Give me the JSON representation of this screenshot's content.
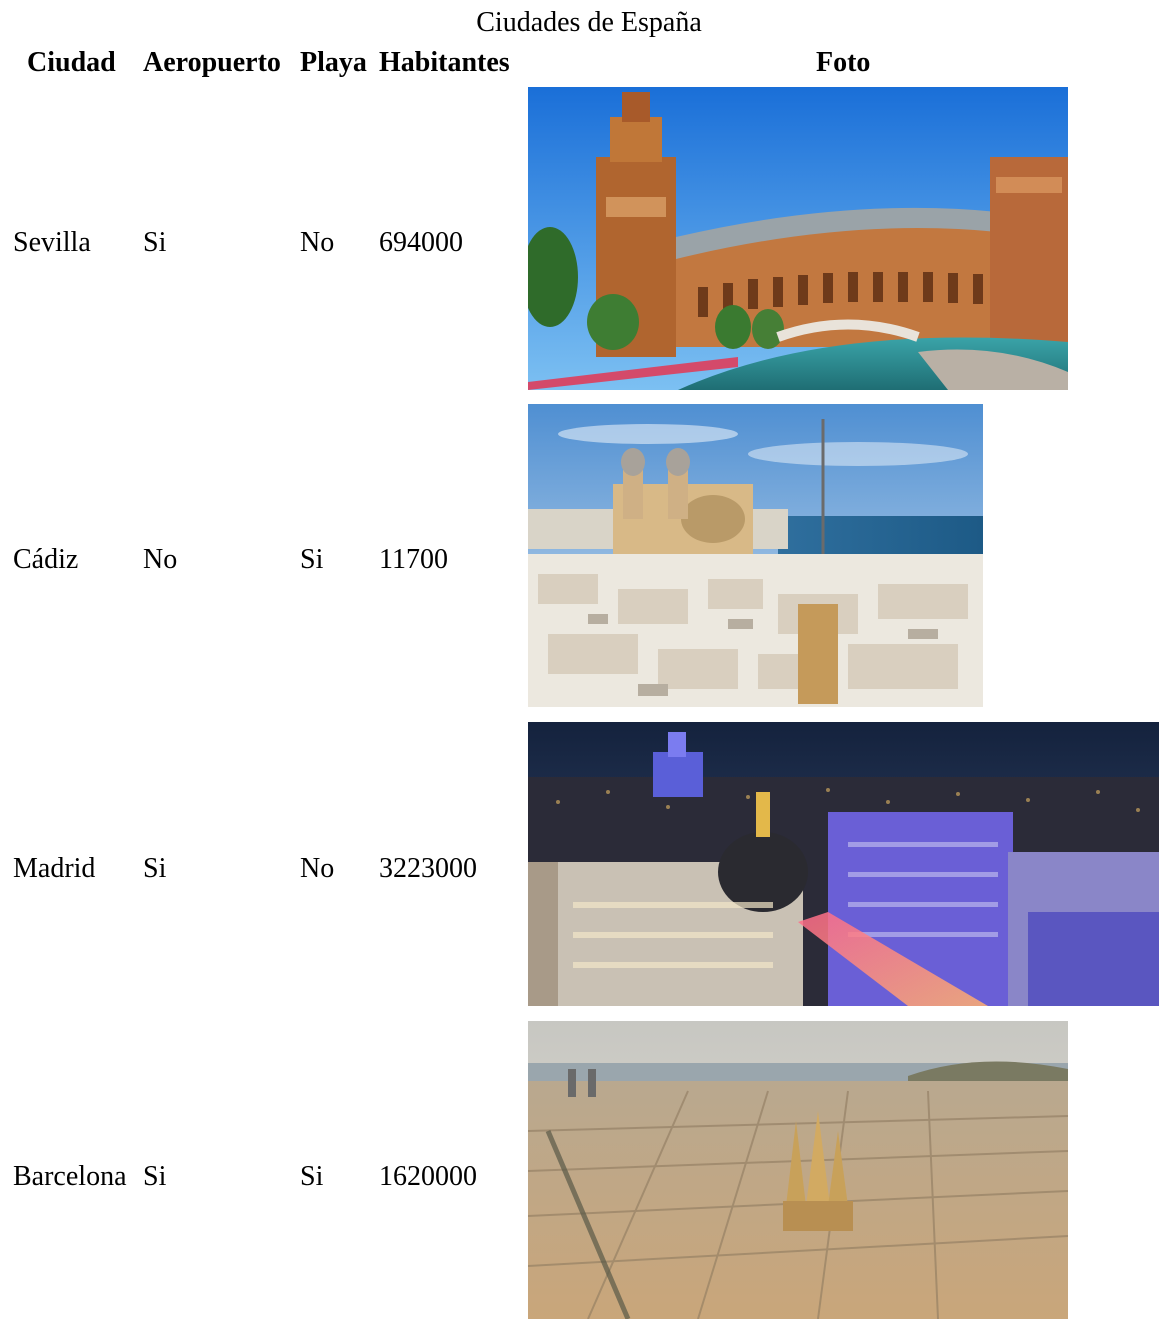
{
  "table": {
    "caption": "Ciudades de España",
    "headers": {
      "ciudad": "Ciudad",
      "aeropuerto": "Aeropuerto",
      "playa": "Playa",
      "habitantes": "Habitantes",
      "foto": "Foto"
    },
    "rows": [
      {
        "ciudad": "Sevilla",
        "aeropuerto": "Si",
        "playa": "No",
        "habitantes": "694000"
      },
      {
        "ciudad": "Cádiz",
        "aeropuerto": "No",
        "playa": "Si",
        "habitantes": "11700"
      },
      {
        "ciudad": "Madrid",
        "aeropuerto": "Si",
        "playa": "No",
        "habitantes": "3223000"
      },
      {
        "ciudad": "Barcelona",
        "aeropuerto": "Si",
        "playa": "Si",
        "habitantes": "1620000"
      }
    ]
  }
}
